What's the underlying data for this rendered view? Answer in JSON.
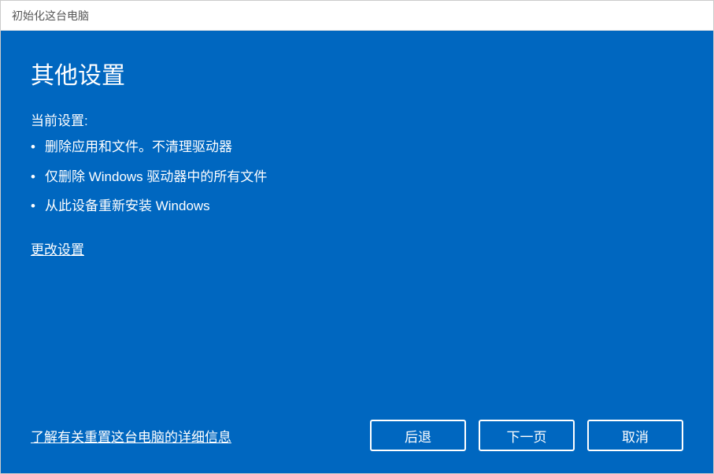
{
  "titlebar": {
    "title": "初始化这台电脑"
  },
  "main": {
    "heading": "其他设置",
    "currentSettingsLabel": "当前设置:",
    "bullets": [
      "删除应用和文件。不清理驱动器",
      "仅删除 Windows 驱动器中的所有文件",
      " 从此设备重新安装 Windows"
    ],
    "changeSettingsLink": "更改设置"
  },
  "footer": {
    "learnMoreLink": "了解有关重置这台电脑的详细信息",
    "buttons": {
      "back": "后退",
      "next": "下一页",
      "cancel": "取消"
    }
  }
}
